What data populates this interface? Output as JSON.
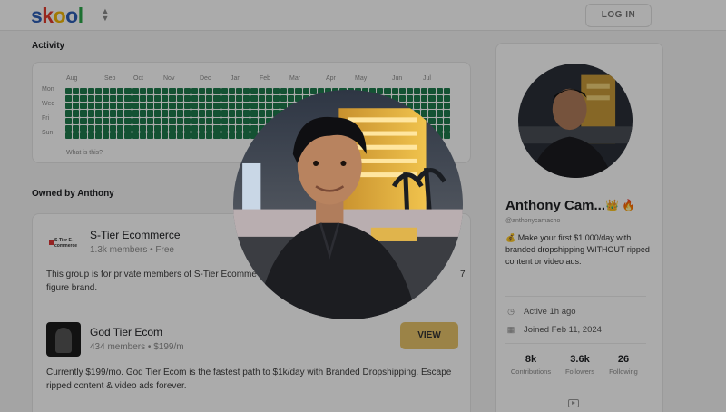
{
  "header": {
    "logo_letters": [
      "s",
      "k",
      "o",
      "o",
      "l"
    ],
    "logo_colors": [
      "#2e5fb6",
      "#e33b2e",
      "#f2b705",
      "#2e5fb6",
      "#2ba84a"
    ],
    "switcher_icon": "chevron-up-down-icon",
    "login_label": "LOG IN"
  },
  "activity": {
    "title": "Activity",
    "months": [
      "Aug",
      "Sep",
      "Oct",
      "Nov",
      "Dec",
      "Jan",
      "Feb",
      "Mar",
      "Apr",
      "May",
      "Jun",
      "Jul"
    ],
    "days": [
      "Mon",
      "Wed",
      "Fri",
      "Sun"
    ],
    "what_is_this": "What is this?",
    "cell_color": "#1e7b4c"
  },
  "owned": {
    "title": "Owned by Anthony",
    "groups": [
      {
        "name": "S-Tier Ecommerce",
        "meta": "1.3k members • Free",
        "icon_text": "S-Tier E-commerce",
        "desc_line1": "This group is for private members of S-Tier Ecomme",
        "desc_line1_tail": "7",
        "desc_line2": "figure brand."
      },
      {
        "name": "God Tier Ecom",
        "meta": "434 members • $199/m",
        "view_label": "VIEW",
        "desc_line1": "Currently $199/mo. God Tier Ecom is the fastest path to $1k/day with Branded Dropshipping. Escape",
        "desc_line2": "ripped content & video ads forever."
      }
    ]
  },
  "profile": {
    "name": "Anthony Cam...",
    "badges": "👑 🔥",
    "handle": "@anthonycamacho",
    "bio": "💰 Make your first $1,000/day with branded dropshipping WITHOUT ripped content or video ads.",
    "active": "Active 1h ago",
    "joined": "Joined Feb 11, 2024",
    "stats": [
      {
        "num": "8k",
        "label": "Contributions"
      },
      {
        "num": "3.6k",
        "label": "Followers"
      },
      {
        "num": "26",
        "label": "Following"
      }
    ]
  }
}
